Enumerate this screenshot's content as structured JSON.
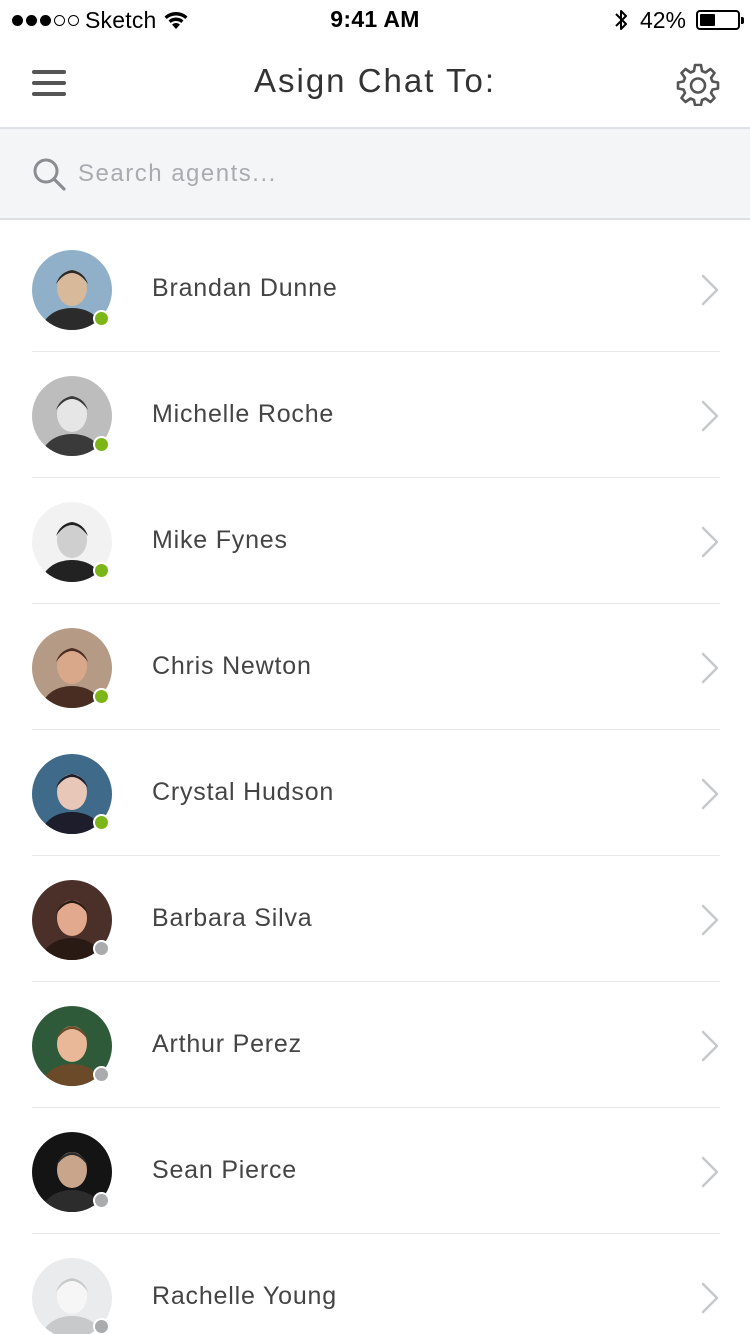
{
  "status_bar": {
    "carrier": "Sketch",
    "time": "9:41 AM",
    "battery_percent_label": "42%",
    "battery_level": 0.42
  },
  "nav": {
    "title": "Asign Chat To:",
    "menu_icon": "hamburger-menu-icon",
    "settings_icon": "gear-icon"
  },
  "search": {
    "placeholder": "Search agents...",
    "value": ""
  },
  "colors": {
    "online": "#7cb517",
    "offline": "#a9abad",
    "divider": "#dde1e5",
    "search_bg": "#f4f5f7"
  },
  "agents": [
    {
      "name": "Brandan Dunne",
      "status": "online"
    },
    {
      "name": "Michelle Roche",
      "status": "online"
    },
    {
      "name": "Mike Fynes",
      "status": "online"
    },
    {
      "name": "Chris Newton",
      "status": "online"
    },
    {
      "name": "Crystal Hudson",
      "status": "online"
    },
    {
      "name": "Barbara Silva",
      "status": "offline"
    },
    {
      "name": "Arthur Perez",
      "status": "offline"
    },
    {
      "name": "Sean Pierce",
      "status": "offline"
    },
    {
      "name": "Rachelle Young",
      "status": "offline"
    }
  ]
}
